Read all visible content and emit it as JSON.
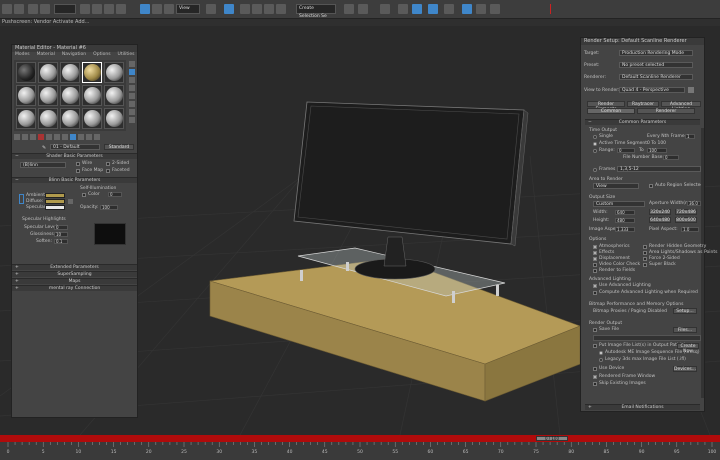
{
  "toolbar": {
    "view_dropdown": "View",
    "selection_set": "Create Selection Se",
    "undo_tip": ""
  },
  "subbar": {
    "text": "Pushscreen: Vendor Activate Add..."
  },
  "material_editor": {
    "title": "Material Editor - Material #6",
    "menus": [
      "Modes",
      "Material",
      "Navigation",
      "Options",
      "Utilities"
    ],
    "material_name": "01 - Default",
    "material_type": "Standard",
    "shader_basic_params_title": "Shader Basic Parameters",
    "shader_type": "(B)linn",
    "wire_label": "Wire",
    "two_sided_label": "2-Sided",
    "face_map_label": "Face Map",
    "faceted_label": "Faceted",
    "blinn_basic_params_title": "Blinn Basic Parameters",
    "self_illum_label": "Self-Illumination",
    "color_label": "Color",
    "ambient_label": "Ambient:",
    "diffuse_label": "Diffuse:",
    "specular_label": "Specular:",
    "opacity_label": "Opacity:",
    "color_value": "0",
    "opacity_value": "100",
    "specular_highlights_title": "Specular Highlights",
    "specular_level_label": "Specular Level:",
    "glossiness_label": "Glossiness:",
    "soften_label": "Soften:",
    "specular_level_value": "0",
    "glossiness_value": "10",
    "soften_value": "0.1",
    "rollouts": [
      "Extended Parameters",
      "SuperSampling",
      "Maps",
      "mental ray Connection"
    ],
    "ambient_color": "#b09a4c",
    "diffuse_color": "#b09a4c",
    "specular_color": "#e8e8e8"
  },
  "render_setup": {
    "title": "Render Setup: Default Scanline Renderer",
    "target_label": "Target:",
    "target_value": "Production Rendering Mode",
    "preset_label": "Preset:",
    "preset_value": "No preset selected",
    "renderer_label": "Renderer:",
    "renderer_value": "Default Scanline Renderer",
    "view_to_render_label": "View to Render:",
    "view_to_render_value": "Quad 4 - Perspective",
    "tabs_row1": [
      "Render Elements",
      "Raytracer",
      "Advanced Lighting"
    ],
    "tabs_row2": [
      "Common",
      "Renderer"
    ],
    "common_params_title": "Common Parameters",
    "time_output_title": "Time Output",
    "single_label": "Single",
    "every_nth_frame_label": "Every Nth Frame:",
    "every_nth_frame_value": "1",
    "active_time_segment_label": "Active Time Segment:",
    "active_time_segment_value": "0 To 100",
    "range_label": "Range:",
    "range_from": "0",
    "to_label": "To",
    "range_to": "100",
    "file_number_base_label": "File Number Base:",
    "file_number_base_value": "0",
    "frames_label": "Frames",
    "frames_value": "1,3,5-12",
    "area_to_render_title": "Area to Render",
    "area_value": "View",
    "auto_region_label": "Auto Region Selected",
    "output_size_title": "Output Size",
    "output_size_value": "Custom",
    "aperture_label": "Aperture Width(mm):",
    "aperture_value": "36.0",
    "width_label": "Width:",
    "width_value": "640",
    "height_label": "Height:",
    "height_value": "480",
    "size_presets": [
      "320x240",
      "720x486",
      "640x480",
      "800x600"
    ],
    "image_aspect_label": "Image Aspect:",
    "image_aspect_value": "1.333",
    "pixel_aspect_label": "Pixel Aspect:",
    "pixel_aspect_value": "1.0",
    "options_title": "Options",
    "options": [
      {
        "label": "Atmospherics",
        "checked": true
      },
      {
        "label": "Render Hidden Geometry",
        "checked": false
      },
      {
        "label": "Effects",
        "checked": true
      },
      {
        "label": "Area Lights/Shadows as Points",
        "checked": false
      },
      {
        "label": "Displacement",
        "checked": true
      },
      {
        "label": "Force 2-Sided",
        "checked": false
      },
      {
        "label": "Video Color Check",
        "checked": false
      },
      {
        "label": "Super Black",
        "checked": false
      },
      {
        "label": "Render to Fields",
        "checked": false
      }
    ],
    "advanced_lighting_title": "Advanced Lighting",
    "use_advanced_lighting_label": "Use Advanced Lighting",
    "compute_adv_lighting_label": "Compute Advanced Lighting when Required",
    "bitmap_performance_title": "Bitmap Performance and Memory Options",
    "bitmap_proxies_label": "Bitmap Proxies / Paging Disabled",
    "setup_button": "Setup...",
    "render_output_title": "Render Output",
    "save_file_label": "Save File",
    "files_button": "Files...",
    "put_image_label": "Put Image File List(s) in Output Path(s)",
    "create_now_button": "Create Now",
    "autodesk_me_label": "Autodesk ME Image Sequence File (.imsq)",
    "legacy_3dsmax_label": "Legacy 3ds max Image File List (.ifl)",
    "use_device_label": "Use Device",
    "devices_button": "Devices...",
    "rendered_frame_window_label": "Rendered Frame Window",
    "skip_existing_label": "Skip Existing Images",
    "email_notifications": "Email Notifications"
  },
  "timeline": {
    "frame_readout": "0 / 100",
    "tick_labels": [
      "0",
      "5",
      "10",
      "15",
      "20",
      "25",
      "30",
      "35",
      "40",
      "45",
      "50",
      "55",
      "60",
      "65",
      "70",
      "75",
      "80",
      "85",
      "90",
      "95",
      "100"
    ]
  },
  "colors": {
    "accent": "#3f86c9",
    "time_bar": "#b00b0b",
    "box": "#b59c5a"
  }
}
